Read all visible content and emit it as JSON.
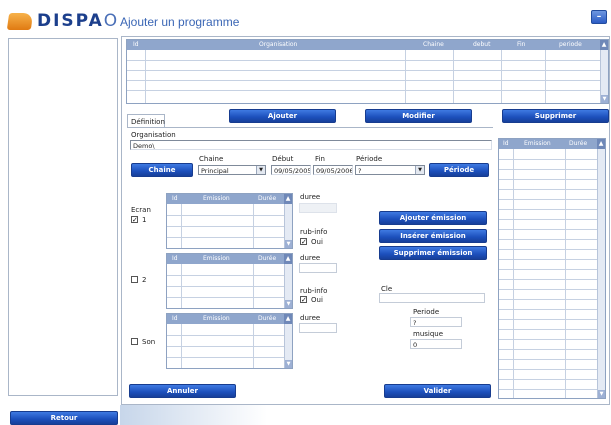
{
  "app": {
    "logo_text": "DISPA",
    "logo_text_thin": "O",
    "title": "Ajouter un programme",
    "minimize_label": "–"
  },
  "top_grid": {
    "columns": [
      "Id",
      "Organisation",
      "Chaine",
      "debut",
      "Fin",
      "periode"
    ]
  },
  "actions": {
    "ajouter": "Ajouter",
    "modifier": "Modifier",
    "supprimer": "Supprimer"
  },
  "tab": {
    "label": "Définition"
  },
  "form": {
    "organisation_label": "Organisation",
    "organisation_value": "Demo\\",
    "chaine_button": "Chaine",
    "chaine_label": "Chaine",
    "chaine_value": "Principal",
    "debut_label": "Début",
    "debut_value": "09/05/2005",
    "fin_label": "Fin",
    "fin_value": "09/05/2006",
    "periode_label": "Période",
    "periode_value": "?",
    "periode_button": "Période"
  },
  "ecran": {
    "label": "Ecran",
    "items": [
      {
        "label": "1",
        "checked": "✓"
      },
      {
        "label": "2",
        "checked": ""
      },
      {
        "label": "Son",
        "checked": ""
      }
    ]
  },
  "emission_grid": {
    "columns": [
      "Id",
      "Emission",
      "Durée"
    ]
  },
  "side": {
    "duree_label": "duree",
    "rubinfo_label": "rub-info",
    "oui_label": "Oui",
    "checked": "✓"
  },
  "emission_buttons": {
    "ajouter": "Ajouter émission",
    "inserer": "Insérer émission",
    "supprimer": "Supprimer émission"
  },
  "cle": {
    "label": "Cle",
    "periode_label": "Periode",
    "periode_value": "?",
    "musique_label": "musique",
    "musique_value": "0"
  },
  "right_grid": {
    "columns": [
      "Id",
      "Emission",
      "Durée"
    ]
  },
  "footer": {
    "annuler": "Annuler",
    "valider": "Valider",
    "retour": "Retour"
  }
}
